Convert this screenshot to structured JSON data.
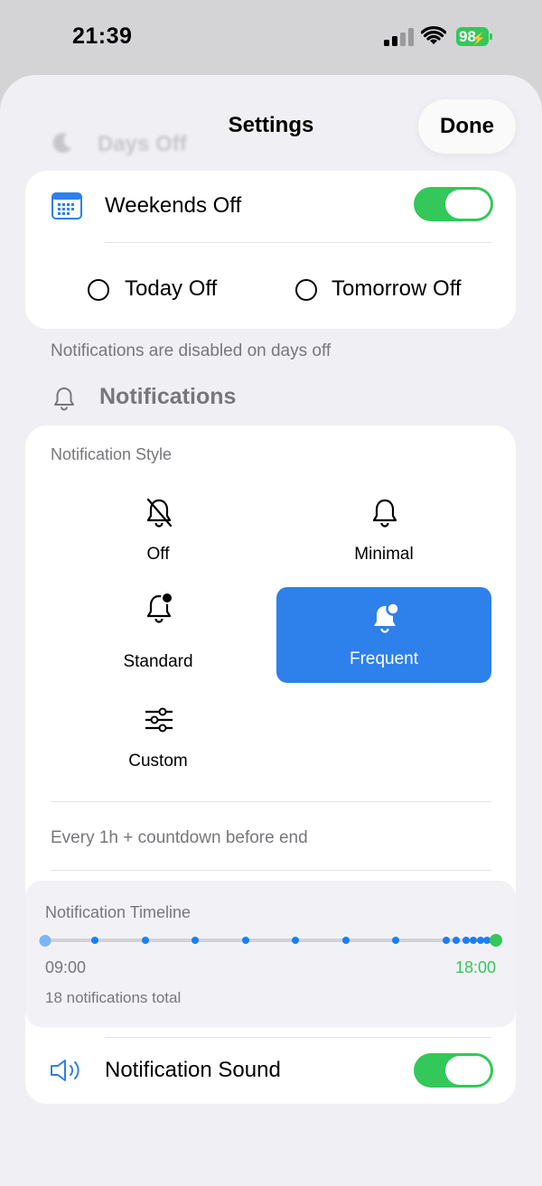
{
  "status_bar": {
    "time": "21:39",
    "battery": "98"
  },
  "header": {
    "title": "Settings",
    "done_label": "Done",
    "ghost_title": "Days Off"
  },
  "days_off": {
    "weekends_label": "Weekends Off",
    "weekends_on": true,
    "today_label": "Today Off",
    "tomorrow_label": "Tomorrow Off",
    "footer": "Notifications are disabled on days off"
  },
  "notifications": {
    "section_title": "Notifications",
    "style_label": "Notification Style",
    "options": [
      {
        "label": "Off",
        "icon": "bell-slash-icon"
      },
      {
        "label": "Minimal",
        "icon": "bell-icon"
      },
      {
        "label": "Standard",
        "icon": "bell-badge-icon"
      },
      {
        "label": "Frequent",
        "icon": "bell-badge-icon",
        "selected": true
      },
      {
        "label": "Custom",
        "icon": "sliders-icon"
      }
    ],
    "description": "Every 1h + countdown before end",
    "timeline": {
      "title": "Notification Timeline",
      "start": "09:00",
      "end": "18:00",
      "total": "18 notifications total",
      "points_hours": [
        0,
        1,
        2,
        3,
        4,
        5,
        6,
        7,
        8,
        8.2,
        8.4,
        8.55,
        8.7,
        8.82,
        8.92,
        9
      ]
    },
    "sound_label": "Notification Sound",
    "sound_on": true
  },
  "colors": {
    "accent": "#2e80ea",
    "toggle_on": "#34c759",
    "secondary_text": "#77777b"
  }
}
